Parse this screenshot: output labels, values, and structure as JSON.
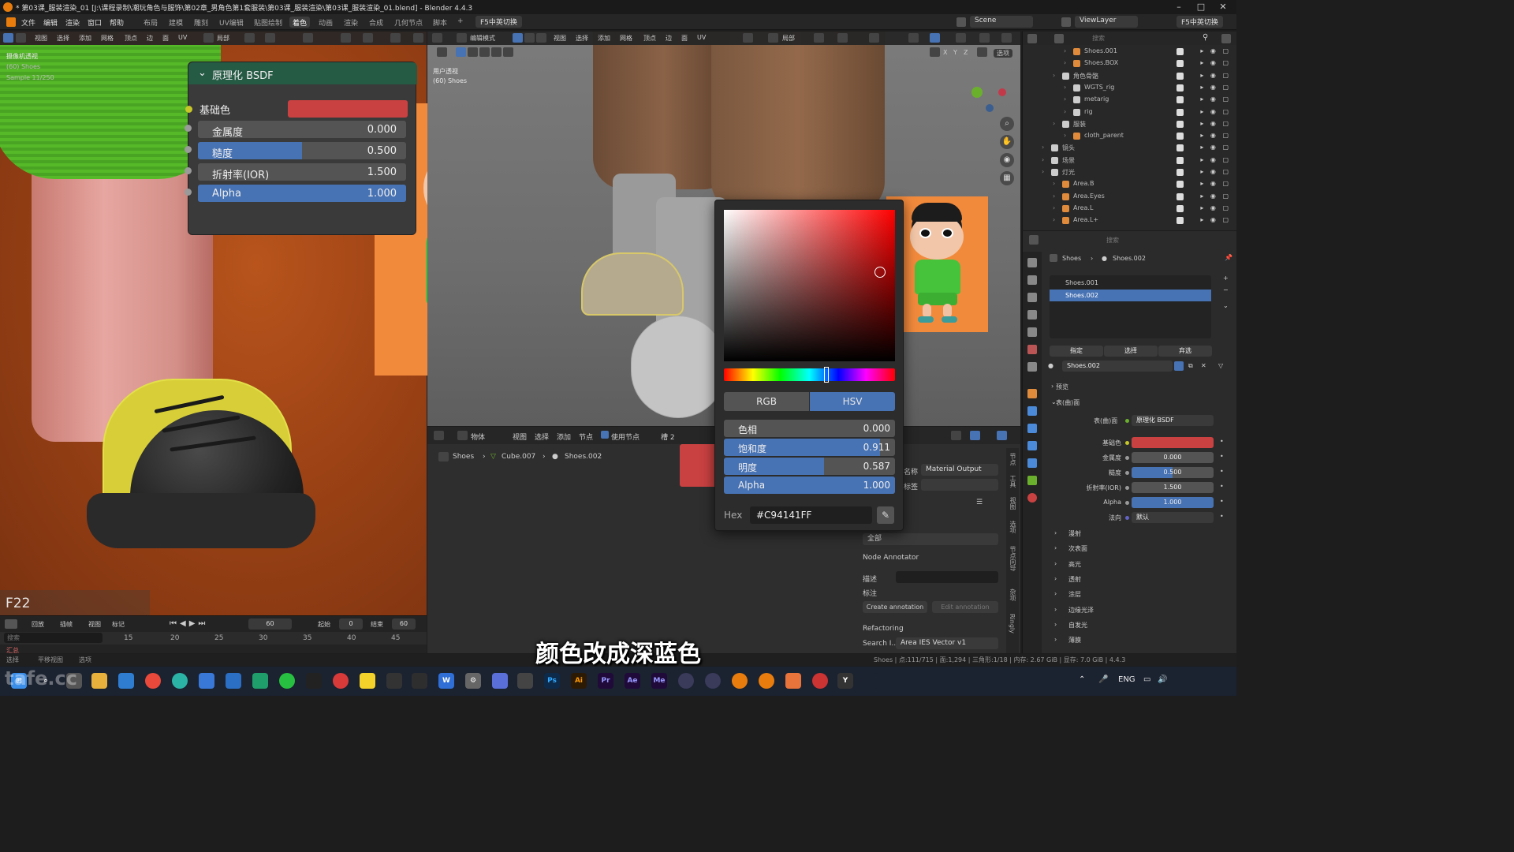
{
  "titlebar": {
    "title": "* 第03课_服装渲染_01 [J:\\课程录制\\潮玩角色与服饰\\第02章_男角色第1套服装\\第03课_服装渲染\\第03课_服装渲染_01.blend] - Blender 4.4.3",
    "minimize": "–",
    "maximize": "□",
    "close": "✕"
  },
  "menubar": {
    "menus": [
      "文件",
      "编辑",
      "渲染",
      "窗口",
      "帮助"
    ],
    "workspaces": [
      "布局",
      "建模",
      "雕刻",
      "UV编辑",
      "贴图绘制",
      "着色",
      "动画",
      "渲染",
      "合成",
      "几何节点",
      "脚本"
    ],
    "active_workspace": "着色",
    "addon_button": "F5中英切换",
    "scene": "Scene",
    "view_layer": "ViewLayer",
    "addon_button_right": "F5中英切换"
  },
  "left_viewport": {
    "header_items": [
      "视图",
      "选择",
      "添加",
      "网格",
      "顶点",
      "边",
      "面",
      "UV"
    ],
    "transform_orientation": "局部",
    "info_lines": [
      "摄像机透视",
      "(60) Shoes",
      "Sample 11/250"
    ],
    "keycast": "F22"
  },
  "timeline": {
    "menus": [
      "回放",
      "插帧",
      "视图",
      "标记"
    ],
    "current_frame": "60",
    "start_label": "起始",
    "start": "0",
    "end_label": "结束",
    "end": "60",
    "ticks": [
      "15",
      "20",
      "25",
      "30",
      "35",
      "40",
      "45"
    ],
    "search_placeholder": "搜索",
    "summary": "汇总"
  },
  "edit_viewport": {
    "mode": "编辑模式",
    "header_items": [
      "视图",
      "选择",
      "添加",
      "网格",
      "顶点",
      "边",
      "面",
      "UV"
    ],
    "transform_orientation": "局部",
    "axes": [
      "X",
      "Y",
      "Z"
    ],
    "options": "选项",
    "info_lines": [
      "用户透视",
      "(60) Shoes"
    ]
  },
  "color_picker": {
    "mode_rgb": "RGB",
    "mode_hsv": "HSV",
    "active_mode": "HSV",
    "hue_label": "色相",
    "hue": "0.000",
    "hue_fraction": 0.0,
    "saturation_label": "饱和度",
    "saturation": "0.911",
    "saturation_fraction": 0.911,
    "value_label": "明度",
    "value": "0.587",
    "value_fraction": 0.587,
    "alpha_label": "Alpha",
    "alpha": "1.000",
    "alpha_fraction": 1.0,
    "hex_label": "Hex",
    "hex": "#C94141FF",
    "current_color": "#c94141",
    "hue_slider_fraction": 0.6
  },
  "node_editor": {
    "header": {
      "editor_type": "物体",
      "menus": [
        "视图",
        "选择",
        "添加",
        "节点"
      ],
      "use_nodes_label": "使用节点",
      "slot": "槽 2"
    },
    "breadcrumb": [
      "Shoes",
      "Cube.007",
      "Shoes.002"
    ],
    "node": {
      "title": "原理化 BSDF",
      "base_color_label": "基础色",
      "base_color": "#c94141",
      "rows": [
        {
          "label": "金属度",
          "value": "0.000",
          "fraction": 0.0,
          "highlight": false
        },
        {
          "label": "糙度",
          "value": "0.500",
          "fraction": 0.5,
          "highlight": true
        },
        {
          "label": "折射率(IOR)",
          "value": "1.500",
          "fraction": 0.0,
          "highlight": false
        },
        {
          "label": "Alpha",
          "value": "1.000",
          "fraction": 1.0,
          "highlight": true
        }
      ]
    },
    "sidebar": {
      "name_label": "名称",
      "material_output": "Material Output",
      "label_label": "标签",
      "filter": "全部",
      "section": "Node Annotator",
      "desc_label": "描述",
      "annotation_label": "标注",
      "create_annotation": "Create annotation",
      "edit_annotation": "Edit annotation",
      "refactoring": "Refactoring",
      "search_label": "Search I...",
      "search_value": "Area IES Vector v1"
    },
    "vertical_tabs": [
      "节点",
      "工具",
      "视图",
      "选项",
      "节点向导",
      "杂项",
      "Ringly"
    ]
  },
  "outliner": {
    "search_placeholder": "搜索",
    "rows": [
      {
        "name": "Shoes.001",
        "indent": 3,
        "color": "#e08a3b"
      },
      {
        "name": "Shoes.BOX",
        "indent": 3,
        "color": "#e08a3b"
      },
      {
        "name": "角色骨骼",
        "indent": 2,
        "color": "#cccccc"
      },
      {
        "name": "WGTS_rig",
        "indent": 3,
        "color": "#cccccc"
      },
      {
        "name": "metarig",
        "indent": 3,
        "color": "#cccccc"
      },
      {
        "name": "rig",
        "indent": 3,
        "color": "#cccccc"
      },
      {
        "name": "服装",
        "indent": 2,
        "color": "#cccccc"
      },
      {
        "name": "cloth_parent",
        "indent": 3,
        "color": "#e08a3b"
      },
      {
        "name": "镜头",
        "indent": 1,
        "color": "#cccccc"
      },
      {
        "name": "场景",
        "indent": 1,
        "color": "#cccccc"
      },
      {
        "name": "灯光",
        "indent": 1,
        "color": "#cccccc"
      },
      {
        "name": "Area.B",
        "indent": 2,
        "color": "#e08a3b"
      },
      {
        "name": "Area.Eyes",
        "indent": 2,
        "color": "#e08a3b"
      },
      {
        "name": "Area.L",
        "indent": 2,
        "color": "#e08a3b"
      },
      {
        "name": "Area.L+",
        "indent": 2,
        "color": "#e08a3b"
      }
    ]
  },
  "properties": {
    "search_placeholder": "搜索",
    "breadcrumb": [
      "Shoes",
      "Shoes.002"
    ],
    "slots": [
      "Shoes.001",
      "Shoes.002"
    ],
    "active_slot": "Shoes.002",
    "assign": "指定",
    "select": "选择",
    "deselect": "弃选",
    "material_name": "Shoes.002",
    "preview": "预览",
    "surface_section": "表(曲)面",
    "surface_label": "表(曲)面",
    "surface_value": "原理化 BSDF",
    "fields": [
      {
        "label": "基础色",
        "value": "",
        "fraction": 0.0,
        "color": "#c94141"
      },
      {
        "label": "金属度",
        "value": "0.000",
        "fraction": 0.0,
        "color": ""
      },
      {
        "label": "糙度",
        "value": "0.500",
        "fraction": 0.5,
        "color": ""
      },
      {
        "label": "折射率(IOR)",
        "value": "1.500",
        "fraction": 0.0,
        "color": ""
      },
      {
        "label": "Alpha",
        "value": "1.000",
        "fraction": 1.0,
        "color": ""
      },
      {
        "label": "法向",
        "value": "默认",
        "fraction": 0.0,
        "color": ""
      }
    ],
    "sections": [
      "漫射",
      "次表面",
      "高光",
      "透射",
      "涂层",
      "边缘光泽",
      "自发光",
      "薄膜"
    ]
  },
  "statusbar": {
    "left": [
      "选择",
      "平移视图",
      "选项"
    ],
    "right": "Shoes | 点:111/715 | 面:1,294 | 三角形:1/18 | 内存: 2.67 GiB | 显存: 7.0 GiB | 4.4.3"
  },
  "taskbar": {
    "language": "ENG"
  },
  "subtitle": "颜色改成深蓝色",
  "watermark": "tafe.cc"
}
